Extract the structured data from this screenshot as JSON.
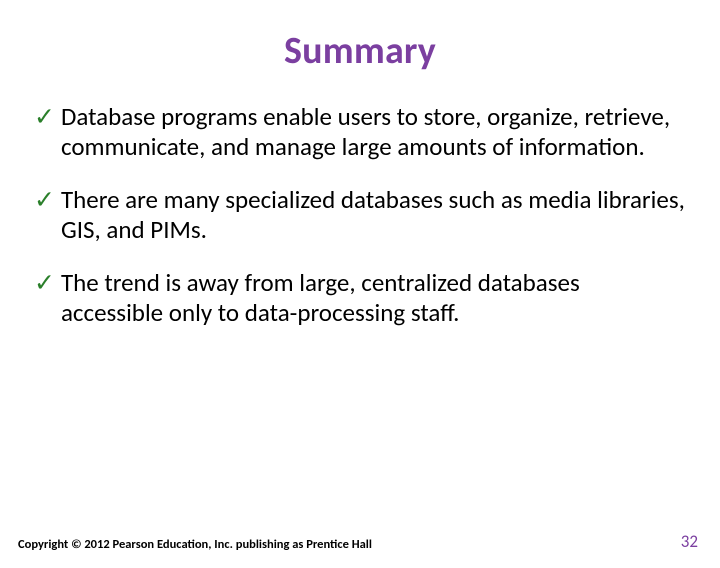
{
  "title": "Summary",
  "bullets": [
    "Database programs enable users to store, organize, retrieve, communicate, and manage large amounts of information.",
    "There are many specialized databases such as media libraries, GIS, and PIMs.",
    "The trend is away from large, centralized databases accessible only to data-processing staff."
  ],
  "checkmark": "✓",
  "footer": {
    "copyright": "Copyright © 2012 Pearson Education, Inc. publishing as Prentice Hall",
    "page_number": "32"
  },
  "colors": {
    "accent": "#7b3fa0",
    "check": "#2a7f2a"
  }
}
